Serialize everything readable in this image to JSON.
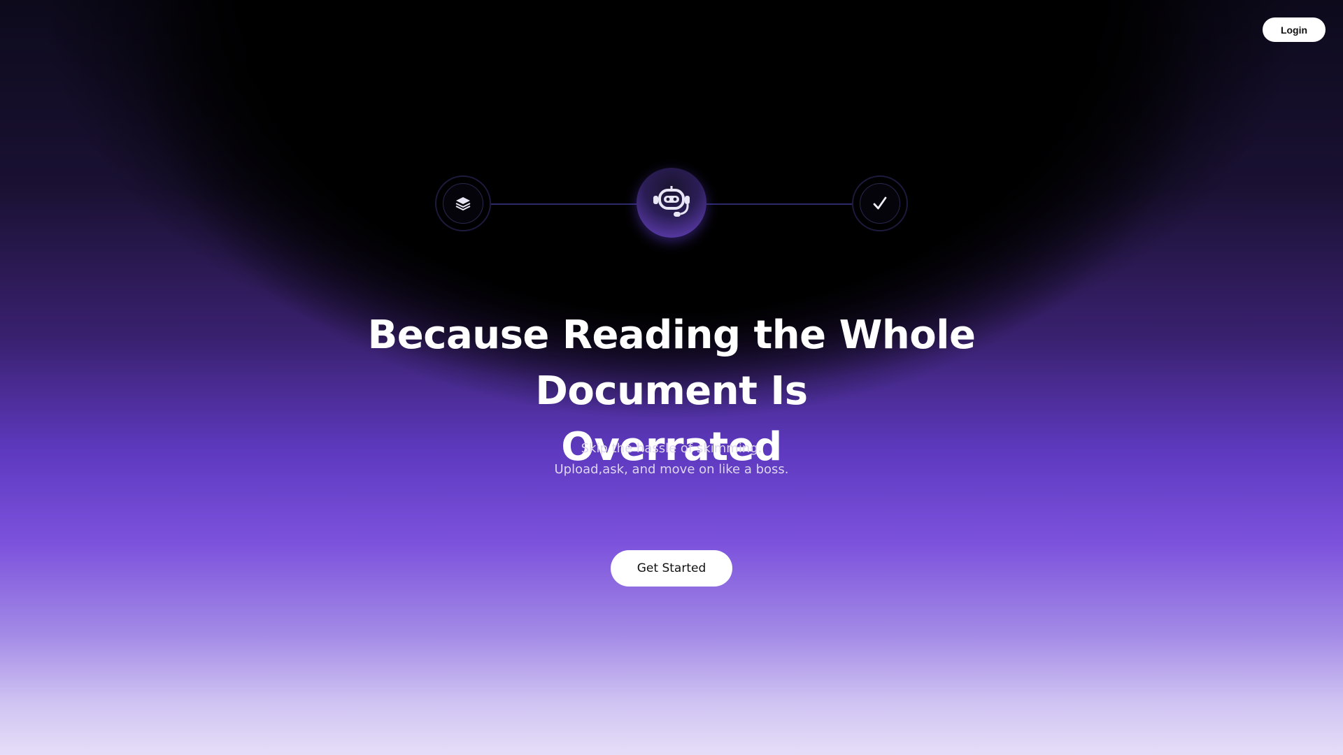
{
  "header": {
    "login_label": "Login"
  },
  "steps": {
    "icons": [
      "layers-icon",
      "robot-assistant-icon",
      "check-icon"
    ],
    "check_glyph": "✓"
  },
  "hero": {
    "headline_line1": "Because Reading the Whole Document Is",
    "headline_line2": "Overrated",
    "subtitle_line1": "Skip the hassle of skimming.",
    "subtitle_line2": "Upload,ask, and move on like a boss.",
    "cta_label": "Get Started"
  },
  "colors": {
    "background_top": "#000000",
    "accent_purple": "#7c52dc",
    "background_bottom": "#e6def8",
    "button_bg": "#ffffff",
    "button_text": "#111111"
  }
}
